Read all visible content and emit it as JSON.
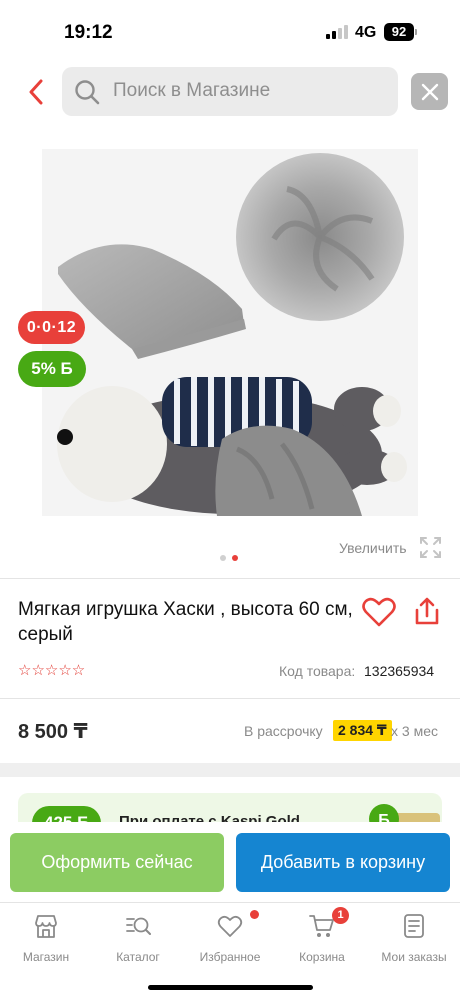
{
  "status_bar": {
    "time": "19:12",
    "network": "4G",
    "battery": "92"
  },
  "search": {
    "placeholder": "Поиск в Магазине"
  },
  "product": {
    "badge_promo": "0·0·12",
    "badge_bonus": "5% Б",
    "zoom_label": "Увеличить",
    "gallery": {
      "count": 2,
      "active_index": 1
    },
    "title": "Мягкая игрушка Хаски , высота 60 см, серый",
    "rating_stars": "☆☆☆☆☆",
    "rating": 0,
    "sku_label": "Код товара:",
    "sku": "132365934",
    "price": "8 500 ₸",
    "installment_label": "В рассрочку",
    "installment_amount": "2 834 ₸",
    "installment_period": "х 3 мес"
  },
  "promo": {
    "amount": "425 Б",
    "text": "При оплате с Kaspi Gold"
  },
  "actions": {
    "order_now": "Оформить сейчас",
    "add_to_cart": "Добавить в корзину"
  },
  "nav": {
    "items": [
      {
        "label": "Магазин",
        "icon": "store-icon"
      },
      {
        "label": "Каталог",
        "icon": "catalog-search-icon"
      },
      {
        "label": "Избранное",
        "icon": "heart-icon"
      },
      {
        "label": "Корзина",
        "icon": "cart-icon"
      },
      {
        "label": "Мои заказы",
        "icon": "orders-icon"
      }
    ],
    "cart_count": "1"
  },
  "colors": {
    "accent_red": "#e8403a",
    "bonus_green": "#48a914",
    "primary_blue": "#1585d1",
    "order_green": "#8ccc62",
    "installment_yellow": "#ffd500"
  }
}
